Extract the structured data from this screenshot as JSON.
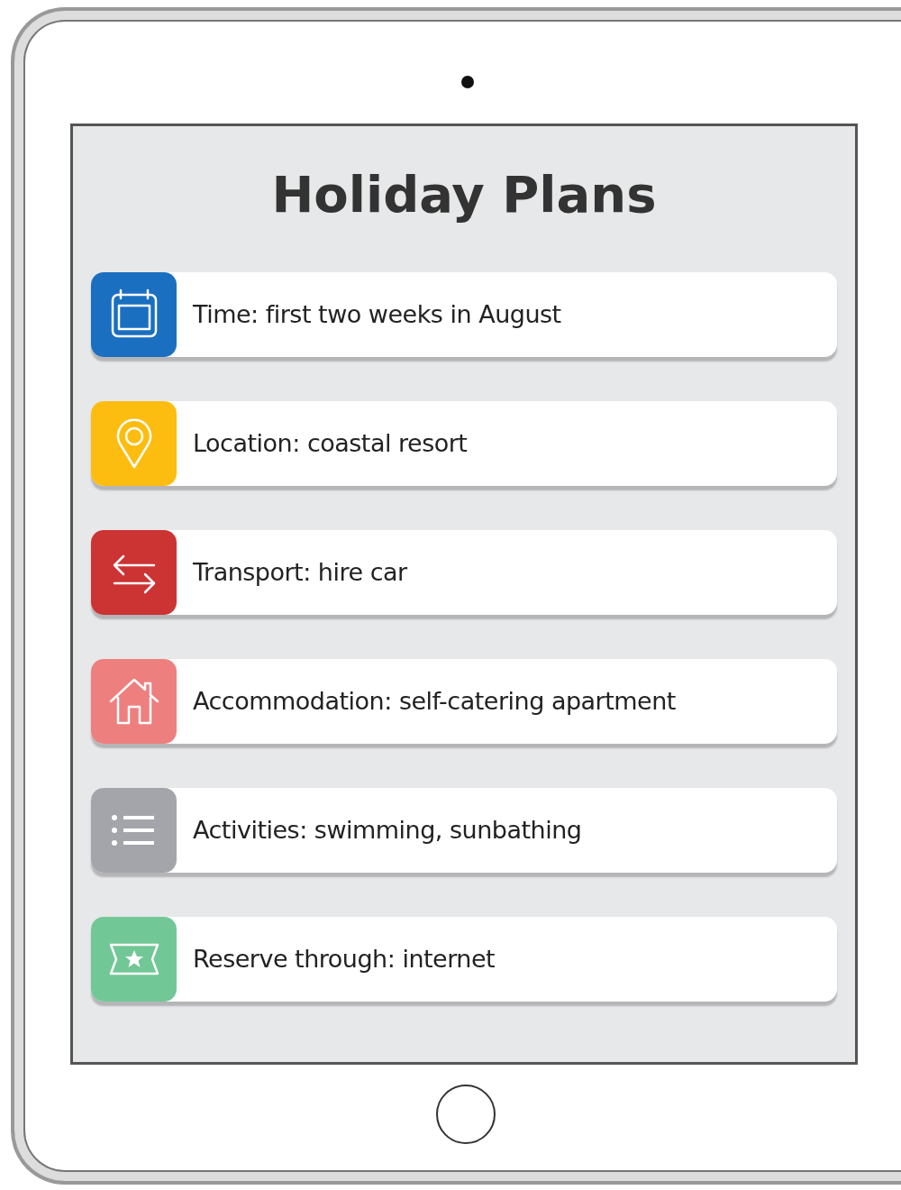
{
  "title": "Holiday Plans",
  "items": [
    {
      "kind": "calendar",
      "color": "#1a6fc0",
      "text": "Time: first two weeks in August"
    },
    {
      "kind": "pin",
      "color": "#fdbd10",
      "text": "Location: coastal resort"
    },
    {
      "kind": "arrows",
      "color": "#cc3333",
      "text": "Transport: hire car"
    },
    {
      "kind": "house",
      "color": "#ee7f7f",
      "text": "Accommodation: self-catering apartment"
    },
    {
      "kind": "list",
      "color": "#a3a5aa",
      "text": "Activities: swimming, sunbathing"
    },
    {
      "kind": "ticket",
      "color": "#72c796",
      "text": "Reserve through: internet"
    }
  ]
}
